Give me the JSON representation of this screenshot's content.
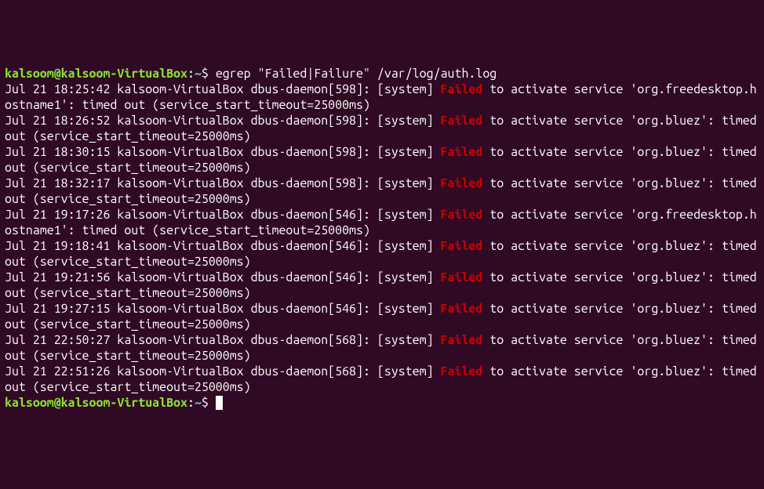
{
  "prompt": {
    "user_host": "kalsoom@kalsoom-VirtualBox",
    "separator": ":",
    "path": "~",
    "dollar": "$"
  },
  "command": {
    "cmd": "egrep",
    "args": "\"Failed|Failure\" /var/log/auth.log"
  },
  "entries": [
    {
      "prefix": "Jul 21 18:25:42 kalsoom-VirtualBox dbus-daemon[598]: [system] ",
      "match": "Failed",
      "suffix": " to activate service 'org.freedesktop.hostname1': timed out (service_start_timeout=25000ms)"
    },
    {
      "prefix": "Jul 21 18:26:52 kalsoom-VirtualBox dbus-daemon[598]: [system] ",
      "match": "Failed",
      "suffix": " to activate service 'org.bluez': timed out (service_start_timeout=25000ms)"
    },
    {
      "prefix": "Jul 21 18:30:15 kalsoom-VirtualBox dbus-daemon[598]: [system] ",
      "match": "Failed",
      "suffix": " to activate service 'org.bluez': timed out (service_start_timeout=25000ms)"
    },
    {
      "prefix": "Jul 21 18:32:17 kalsoom-VirtualBox dbus-daemon[598]: [system] ",
      "match": "Failed",
      "suffix": " to activate service 'org.bluez': timed out (service_start_timeout=25000ms)"
    },
    {
      "prefix": "Jul 21 19:17:26 kalsoom-VirtualBox dbus-daemon[546]: [system] ",
      "match": "Failed",
      "suffix": " to activate service 'org.freedesktop.hostname1': timed out (service_start_timeout=25000ms)"
    },
    {
      "prefix": "Jul 21 19:18:41 kalsoom-VirtualBox dbus-daemon[546]: [system] ",
      "match": "Failed",
      "suffix": " to activate service 'org.bluez': timed out (service_start_timeout=25000ms)"
    },
    {
      "prefix": "Jul 21 19:21:56 kalsoom-VirtualBox dbus-daemon[546]: [system] ",
      "match": "Failed",
      "suffix": " to activate service 'org.bluez': timed out (service_start_timeout=25000ms)"
    },
    {
      "prefix": "Jul 21 19:27:15 kalsoom-VirtualBox dbus-daemon[546]: [system] ",
      "match": "Failed",
      "suffix": " to activate service 'org.bluez': timed out (service_start_timeout=25000ms)"
    },
    {
      "prefix": "Jul 21 22:50:27 kalsoom-VirtualBox dbus-daemon[568]: [system] ",
      "match": "Failed",
      "suffix": " to activate service 'org.bluez': timed out (service_start_timeout=25000ms)"
    },
    {
      "prefix": "Jul 21 22:51:26 kalsoom-VirtualBox dbus-daemon[568]: [system] ",
      "match": "Failed",
      "suffix": " to activate service 'org.bluez': timed out (service_start_timeout=25000ms)"
    }
  ]
}
